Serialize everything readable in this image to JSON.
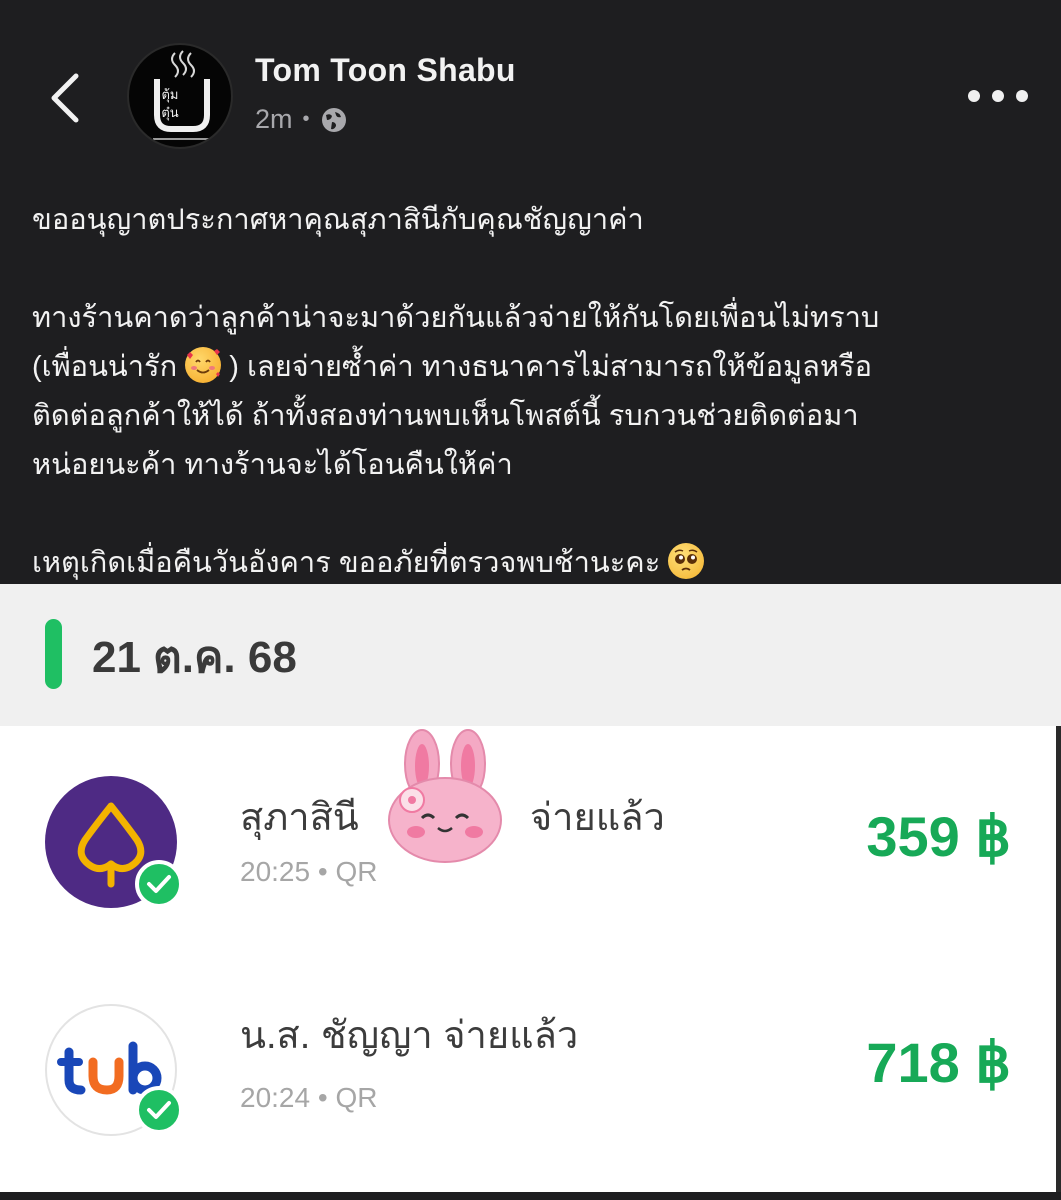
{
  "post": {
    "page_name": "Tom Toon Shabu",
    "avatar_logo_text": "ตุ้มตุ๋น",
    "time": "2m",
    "visibility_icon": "globe-icon",
    "paragraph_1": "ขออนุญาตประกาศหาคุณสุภาสินีกับคุณชัญญาค่า",
    "paragraph_2_line_1": "ทางร้านคาดว่าลูกค้าน่าจะมาด้วยกันแล้วจ่ายให้กันโดยเพื่อนไม่ทราบ",
    "paragraph_2_line_2a": "(เพื่อนน่ารัก",
    "paragraph_2_line_2b": ") เลยจ่ายซ้ำค่า ทางธนาคารไม่สามารถให้ข้อมูลหรือ",
    "paragraph_2_line_3": "ติดต่อลูกค้าให้ได้ ถ้าทั้งสองท่านพบเห็นโพสต์นี้ รบกวนช่วยติดต่อมา",
    "paragraph_2_line_4": "หน่อยนะค้า ทางร้านจะได้โอนคืนให้ค่า",
    "paragraph_3": "เหตุเกิดเมื่อคืนวันอังคาร ขออภัยที่ตรวจพบช้านะคะ"
  },
  "date_header": "21 ต.ค. 68",
  "transactions": [
    {
      "bank_icon": "scb-bank-logo",
      "payer_first": "สุภาสินี",
      "payer_status": "จ่ายแล้ว",
      "time": "20:25",
      "method": "QR",
      "amount": "359 ฿"
    },
    {
      "bank_icon": "ttb-bank-logo",
      "payer": "น.ส. ชัญญา จ่ายแล้ว",
      "time": "20:24",
      "method": "QR",
      "amount": "718 ฿"
    }
  ],
  "colors": {
    "post_bg": "#1e1e20",
    "accent_green": "#1fbf63",
    "amount_green": "#17a957",
    "scb_purple": "#4e2a84",
    "scb_gold": "#f3b300",
    "ttb_blue": "#1947b8",
    "ttb_orange": "#f26c21"
  }
}
